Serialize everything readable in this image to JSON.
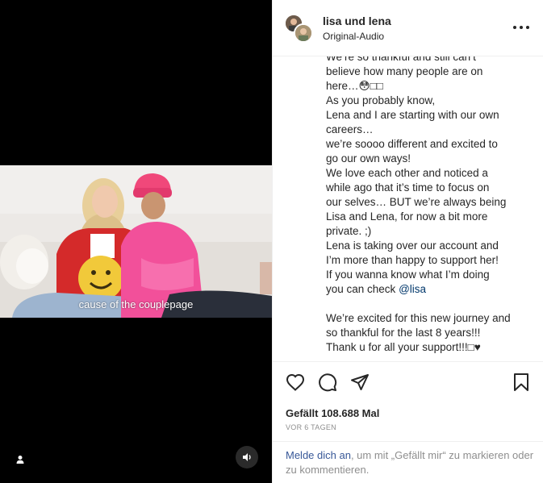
{
  "post": {
    "username": "lisa und lena",
    "audio_label": "Original-Audio",
    "caption": {
      "lines": [
        "We’re so thankful and still can’t",
        "believe how many people are on",
        "here…😳□□",
        "As you probably know,",
        "Lena and I are starting with our own",
        "careers…",
        "we’re soooo different and excited to",
        "go our own ways!",
        "We love each other and noticed a",
        "while ago that it’s time to focus on",
        "our selves… BUT we’re always being",
        "Lisa and Lena, for now a bit more",
        "private. ;)",
        "Lena is taking over our account and",
        "I’m more than happy to support her!",
        "If you wanna know what I’m doing"
      ],
      "check_prefix": "you can check ",
      "mention": "@lisa",
      "closing_lines": [
        "",
        "We’re excited for this new journey and",
        "so thankful for the last 8 years!!!",
        "Thank u for all your support!!!□♥"
      ]
    },
    "likes_text": "Gefällt 108.688 Mal",
    "timestamp": "VOR 6 TAGEN",
    "login_link": "Melde dich an",
    "login_rest": ", um mit „Gefällt mir“ zu markieren oder zu kommentieren."
  },
  "video": {
    "subtitle": "cause of the couplepage"
  },
  "icons": {
    "user_tag": "user-icon",
    "mute": "speaker-icon",
    "like": "heart-icon",
    "comment": "comment-icon",
    "share": "paper-plane-icon",
    "save": "bookmark-icon",
    "more": "more-options-icon"
  },
  "colors": {
    "text": "#262626",
    "muted": "#8e8e8e",
    "link": "#385898",
    "mention": "#00376b",
    "divider": "#efefef"
  }
}
